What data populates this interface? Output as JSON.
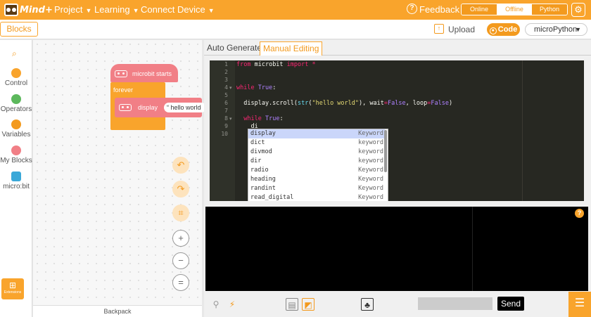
{
  "topbar": {
    "logo_text": "Mind+",
    "menus": [
      "Project",
      "Learning",
      "Connect Device"
    ],
    "feedback": "Feedback",
    "help_icon": "?",
    "modes": [
      "Online",
      "Offline",
      "Python"
    ],
    "active_mode": "Offline",
    "settings_icon": "gear-icon"
  },
  "subbar": {
    "blocks_tab": "Blocks",
    "upload": "Upload",
    "code_button": "Code",
    "device": "microPython"
  },
  "categories": [
    {
      "label": "Control",
      "color": "#f9a42c"
    },
    {
      "label": "Operators",
      "color": "#5cb85c"
    },
    {
      "label": "Variables",
      "color": "#f39a1e"
    },
    {
      "label": "My Blocks",
      "color": "#f17f86"
    },
    {
      "label": "micro:bit",
      "color": "#3aa8d8"
    }
  ],
  "extensions_label": "Extensions",
  "workspace": {
    "hat_label": "microbit starts",
    "forever_label": "forever",
    "display_label": "display",
    "display_value": "hello world",
    "backpack": "Backpack"
  },
  "editor_tabs": [
    "Auto Generate",
    "Manual Editing"
  ],
  "active_editor_tab": "Manual Editing",
  "code_lines": [
    "from microbit import *",
    "",
    "",
    "while True:",
    "",
    "  display.scroll(str(\"hello world\"), wait=False, loop=False)",
    "",
    "  while True:",
    "    di",
    ""
  ],
  "line_numbers": [
    "1",
    "2",
    "3",
    "4",
    "5",
    "6",
    "7",
    "8",
    "9",
    "10"
  ],
  "autocomplete": [
    {
      "word": "display",
      "kind": "Keyword"
    },
    {
      "word": "dict",
      "kind": "keyword"
    },
    {
      "word": "divmod",
      "kind": "keyword"
    },
    {
      "word": "dir",
      "kind": "keyword"
    },
    {
      "word": "radio",
      "kind": "Keyword"
    },
    {
      "word": "heading",
      "kind": "Keyword"
    },
    {
      "word": "randint",
      "kind": "Keyword"
    },
    {
      "word": "read_digital",
      "kind": "Keyword"
    }
  ],
  "console": {
    "send_label": "Send",
    "input_value": ""
  }
}
